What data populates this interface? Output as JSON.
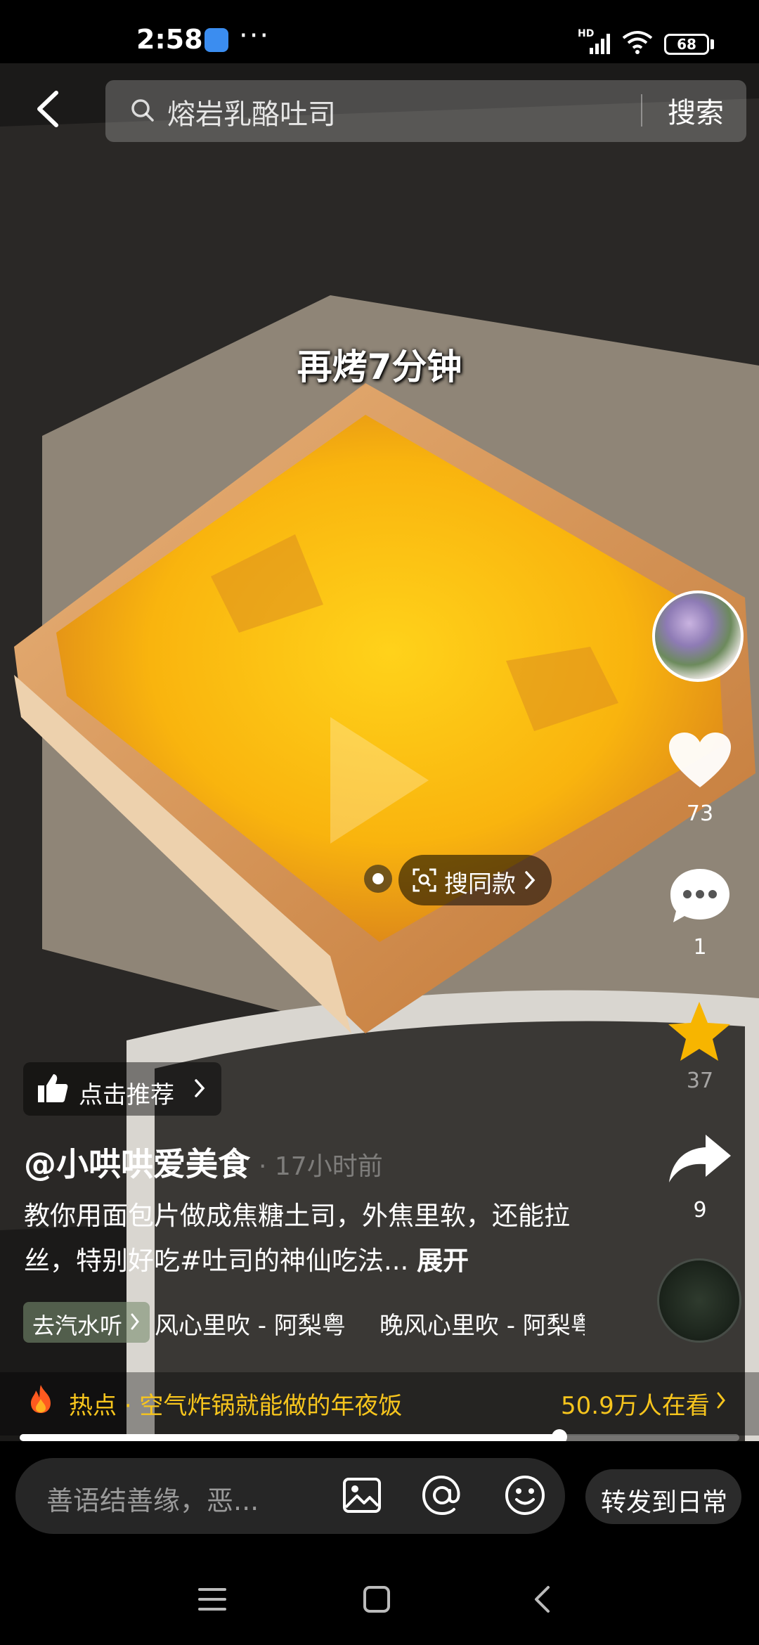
{
  "status_bar": {
    "time": "2:58",
    "more": "···",
    "network_badge": "HD",
    "battery": "68"
  },
  "search": {
    "query": "熔岩乳酪吐司",
    "button_label": "搜索"
  },
  "video": {
    "caption": "再烤7分钟",
    "same_style_label": "搜同款"
  },
  "right_rail": {
    "likes": "73",
    "comments": "1",
    "favorites": "37",
    "shares": "9"
  },
  "post": {
    "recommend_label": "点击推荐",
    "author": "@小哄哄爱美食",
    "time_ago": "· 17小时前",
    "description": "教你用面包片做成焦糖土司，外焦里软，还能拉丝，特别好吃#吐司的神仙吃法...",
    "expand_label": "展开",
    "music_tag": "去汽水听",
    "music_tracks": [
      "风心里吹 - 阿梨粤",
      "晚风心里吹 - 阿梨粤"
    ]
  },
  "hot": {
    "label": "热点 · 空气炸锅就能做的年夜饭",
    "viewers": "50.9万人在看"
  },
  "progress": {
    "fraction": 0.75
  },
  "comment_bar": {
    "placeholder": "善语结善缘，恶...",
    "forward_label": "转发到日常"
  },
  "colors": {
    "accent_yellow": "#f7c51d",
    "favorite_star": "#f7b500"
  }
}
